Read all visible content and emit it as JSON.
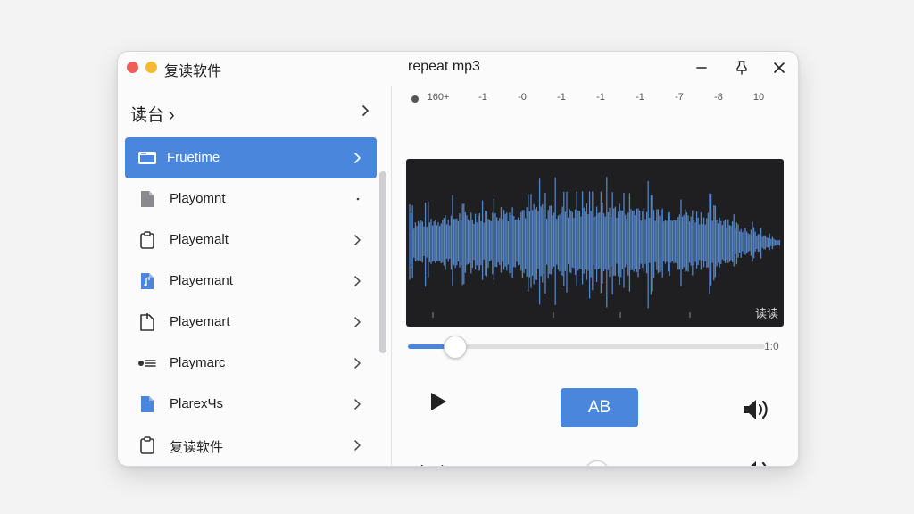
{
  "window": {
    "app_title": "复读软件",
    "title": "repeat mp3"
  },
  "sidebar": {
    "header": "读台 ›",
    "items": [
      {
        "label": "Fruetime",
        "icon": "window-icon",
        "active": true
      },
      {
        "label": "Playomnt",
        "icon": "file-icon"
      },
      {
        "label": "Playemalt",
        "icon": "clipboard-icon"
      },
      {
        "label": "Playemant",
        "icon": "music-file-icon"
      },
      {
        "label": "Playemart",
        "icon": "document-icon"
      },
      {
        "label": "Playmarc",
        "icon": "list-icon"
      },
      {
        "label": "PlarexЧs",
        "icon": "file-icon"
      },
      {
        "label": "复读软件",
        "icon": "clipboard-icon"
      }
    ]
  },
  "timeline": {
    "ticks": [
      "160+",
      "-1",
      "-0",
      "-1",
      "-1",
      "-1",
      "-7",
      "-8",
      "10"
    ]
  },
  "waveform": {
    "label": "读读"
  },
  "seek": {
    "time": "1:0",
    "progress": 0.13
  },
  "controls": {
    "ab_label": "AB"
  },
  "speed": {
    "label": "变速",
    "level": 0.5
  },
  "colors": {
    "accent": "#4a86db",
    "waveform_bg": "#1f1f21",
    "waveform": "#5b8fd6"
  }
}
